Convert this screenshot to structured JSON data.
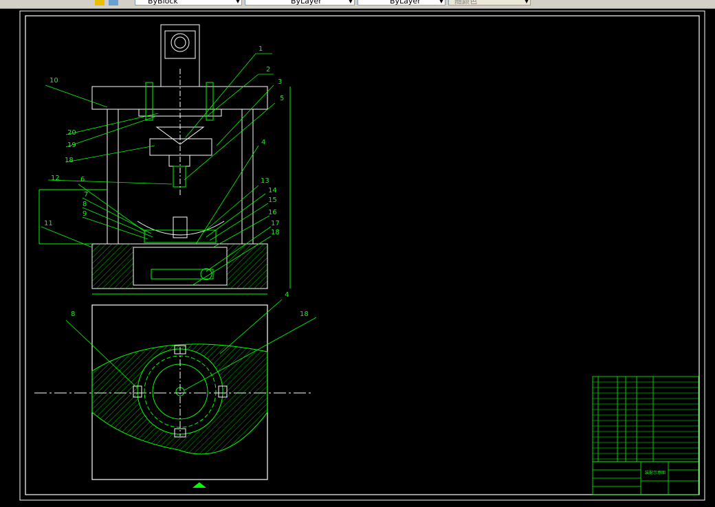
{
  "toolbar": {
    "layer_value": "ByBlock",
    "linetype_value": "ByLayer",
    "lineweight_value": "ByLayer",
    "plotstyle_value": "随颜色"
  },
  "drawing": {
    "callouts": [
      "1",
      "2",
      "3",
      "5",
      "4",
      "13",
      "14",
      "15",
      "16",
      "17",
      "18",
      "10",
      "20",
      "19",
      "18",
      "12",
      "6",
      "7",
      "8",
      "9",
      "11",
      "8",
      "4",
      "18"
    ],
    "title_block_name": "装配示意图",
    "colors": {
      "line": "#00ff00",
      "frame": "#ffffff",
      "hatch": "#00ff00",
      "background": "#000000"
    }
  }
}
